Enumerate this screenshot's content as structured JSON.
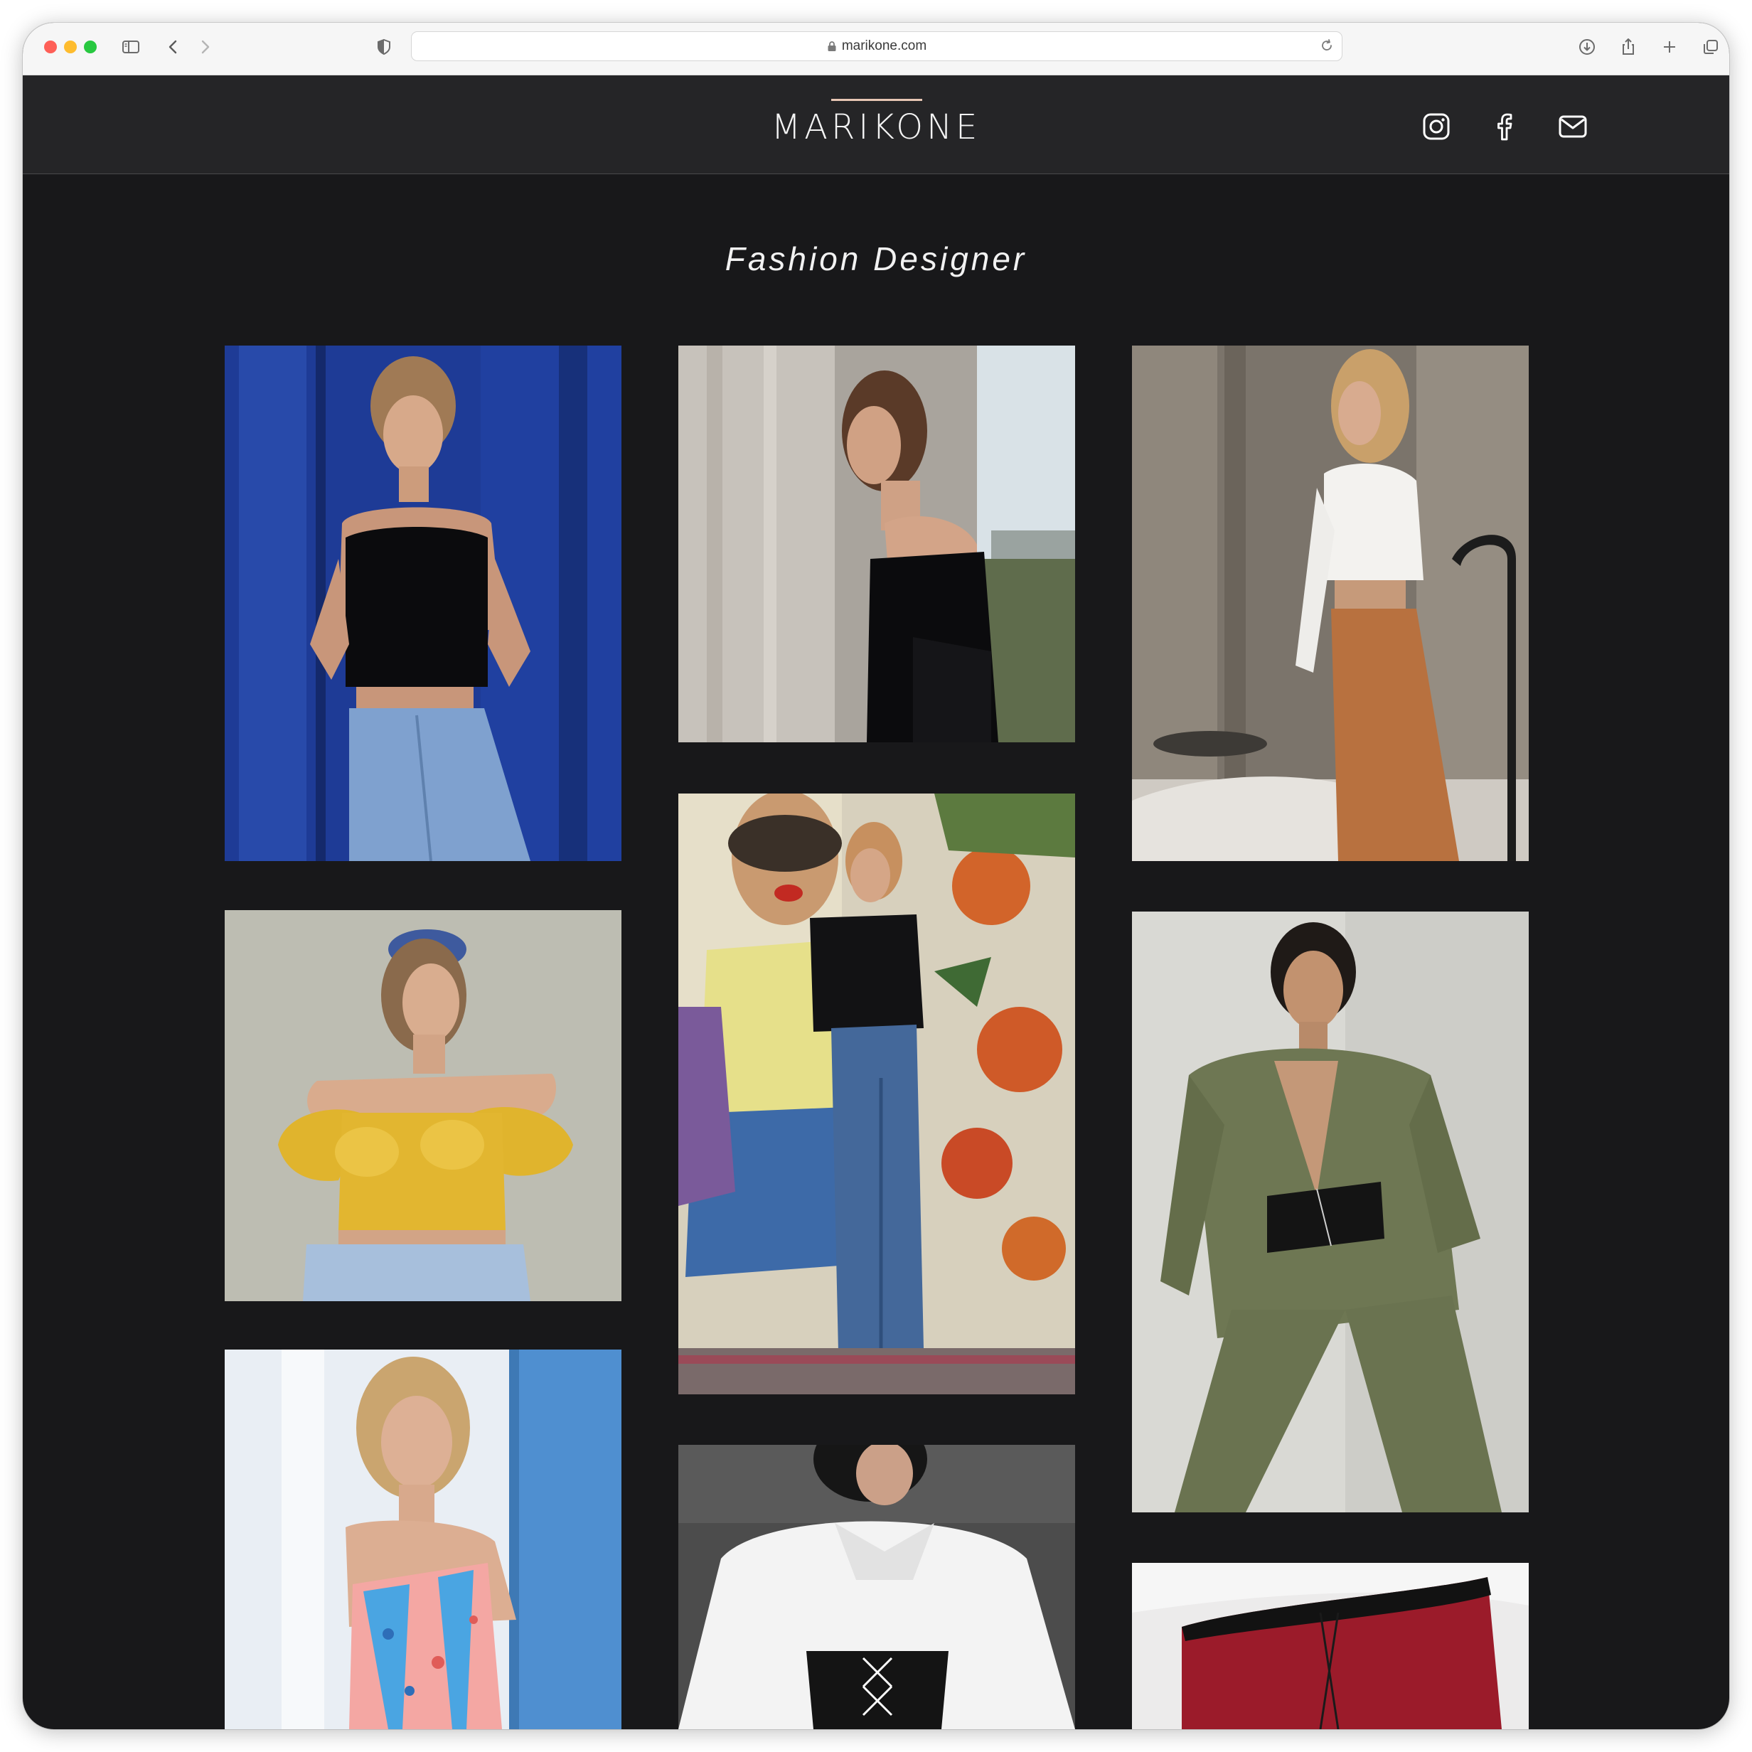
{
  "browser": {
    "url": "marikone.com"
  },
  "site": {
    "logo": "MARIKONE",
    "tagline": "Fashion Designer",
    "social": [
      "instagram-icon",
      "facebook-icon",
      "mail-icon"
    ],
    "accent_color": "#e7c6b4"
  },
  "gallery": [
    {
      "id": "blue-door-black-corset",
      "colors": [
        "#1d3c9a",
        "#0b0b0d",
        "#7fa1cf"
      ]
    },
    {
      "id": "curtain-black-corset",
      "colors": [
        "#b9b3ab",
        "#0c0c0e",
        "#5d6a4a"
      ]
    },
    {
      "id": "white-shirt-tan-trousers",
      "colors": [
        "#8b8378",
        "#f2f0ec",
        "#b97347"
      ]
    },
    {
      "id": "yellow-puff-top",
      "colors": [
        "#bdbdb2",
        "#e1b52f",
        "#9bb4d4"
      ]
    },
    {
      "id": "mural-black-corset",
      "colors": [
        "#d6d0bd",
        "#3d5d8d",
        "#cf5a2a"
      ]
    },
    {
      "id": "olive-suit-corset",
      "colors": [
        "#cfcfca",
        "#6c7551",
        "#141414"
      ]
    },
    {
      "id": "floral-corset-top",
      "colors": [
        "#8eb8e0",
        "#f2a6a0",
        "#49a3e0"
      ]
    },
    {
      "id": "white-shirt-leather-corset",
      "colors": [
        "#4a4a4a",
        "#f3f3f3",
        "#151515"
      ]
    },
    {
      "id": "red-corset-flatlay",
      "colors": [
        "#efeeee",
        "#9c1b2a",
        "#111111"
      ]
    }
  ]
}
